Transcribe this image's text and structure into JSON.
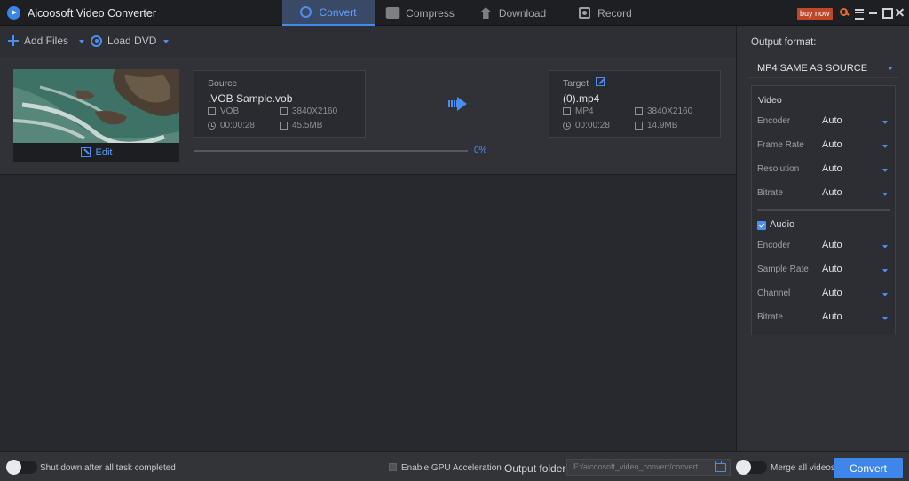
{
  "app": {
    "title": "Aicoosoft Video Converter"
  },
  "tabs": [
    {
      "label": "Convert",
      "icon": "convert-icon",
      "active": true
    },
    {
      "label": "Compress",
      "icon": "compress-icon",
      "active": false
    },
    {
      "label": "Download",
      "icon": "download-icon",
      "active": false
    },
    {
      "label": "Record",
      "icon": "record-icon",
      "active": false
    }
  ],
  "window": {
    "buy_now": "buy now"
  },
  "toolbar": {
    "add_files": "Add Files",
    "load_dvd": "Load DVD"
  },
  "file": {
    "edit": "Edit",
    "source": {
      "label": "Source",
      "name": ".VOB Sample.vob",
      "format": "VOB",
      "resolution": "3840X2160",
      "duration": "00:00:28",
      "size": "45.5MB"
    },
    "target": {
      "label": "Target",
      "name": "(0).mp4",
      "format": "MP4",
      "resolution": "3840X2160",
      "duration": "00:00:28",
      "size": "14.9MB"
    },
    "progress": {
      "value": 0,
      "text": "0%"
    }
  },
  "panel": {
    "output_format_label": "Output format:",
    "output_format_value": "MP4 SAME AS SOURCE",
    "video": {
      "title": "Video",
      "rows": [
        {
          "label": "Encoder",
          "value": "Auto"
        },
        {
          "label": "Frame Rate",
          "value": "Auto"
        },
        {
          "label": "Resolution",
          "value": "Auto"
        },
        {
          "label": "Bitrate",
          "value": "Auto"
        }
      ]
    },
    "audio": {
      "title": "Audio",
      "enabled": true,
      "rows": [
        {
          "label": "Encoder",
          "value": "Auto"
        },
        {
          "label": "Sample Rate",
          "value": "Auto"
        },
        {
          "label": "Channel",
          "value": "Auto"
        },
        {
          "label": "Bitrate",
          "value": "Auto"
        }
      ]
    }
  },
  "footer": {
    "shutdown": "Shut down after all task completed",
    "gpu": "Enable GPU Acceleration",
    "output_folder_label": "Output folder:",
    "output_folder_value": "E:/aicoosoft_video_convert/convert",
    "merge": "Merge all videos",
    "convert": "Convert"
  },
  "colors": {
    "accent": "#3f86ea",
    "buy_now": "#c1472b",
    "background": "#2b2c31"
  }
}
